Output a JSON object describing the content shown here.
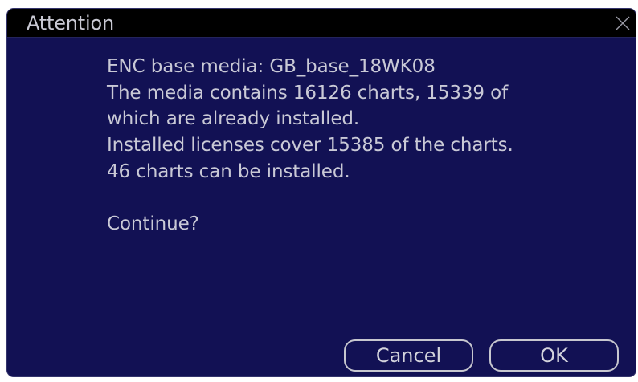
{
  "dialog": {
    "title": "Attention",
    "close_icon": "close-icon",
    "lines": [
      "ENC base media: GB_base_18WK08",
      "The media contains 16126 charts, 15339 of",
      "which are already installed.",
      "Installed licenses cover 15385 of the charts.",
      "46 charts can be installed."
    ],
    "question": "Continue?",
    "cancel_label": "Cancel",
    "ok_label": "OK"
  },
  "colors": {
    "dialog_background": "#121154",
    "titlebar_background": "#000000",
    "text": "#c9c9d6",
    "button_border": "#c7c7cf"
  }
}
